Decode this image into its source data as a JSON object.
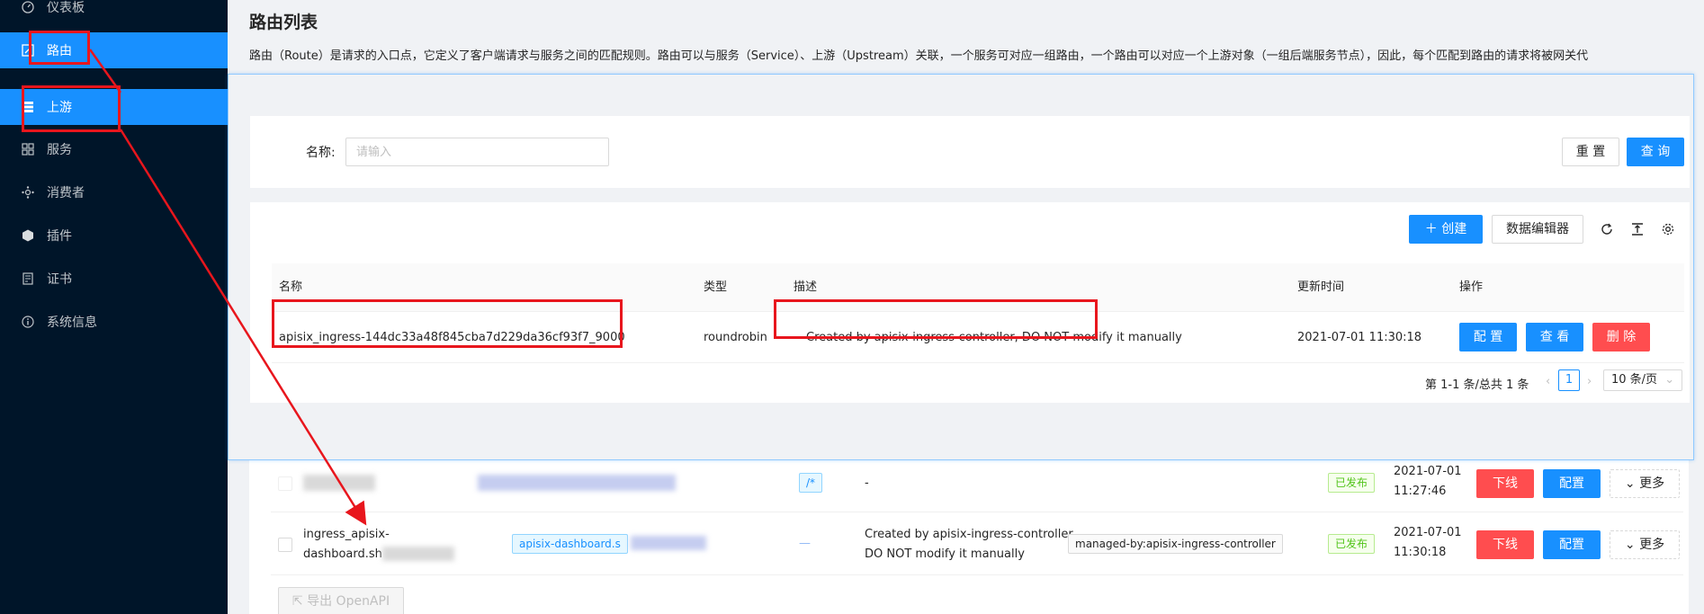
{
  "sidebar": {
    "items": [
      {
        "label": "仪表板",
        "icon": "dashboard-icon"
      },
      {
        "label": "路由",
        "icon": "route-icon"
      },
      {
        "label": "上游",
        "icon": "upstream-icon"
      },
      {
        "label": "服务",
        "icon": "service-icon"
      },
      {
        "label": "消费者",
        "icon": "consumer-icon"
      },
      {
        "label": "插件",
        "icon": "plugin-icon"
      },
      {
        "label": "证书",
        "icon": "certificate-icon"
      },
      {
        "label": "系统信息",
        "icon": "info-icon"
      }
    ],
    "bg_color": "#001529",
    "active_color": "#1890ff"
  },
  "page": {
    "title": "路由列表",
    "description": "路由（Route）是请求的入口点，它定义了客户端请求与服务之间的匹配规则。路由可以与服务（Service）、上游（Upstream）关联，一个服务可对应一组路由，一个路由可以对应一个上游对象（一组后端服务节点），因此，每个匹配到路由的请求将被网关代"
  },
  "route_table": {
    "rows": [
      {
        "desc": "-",
        "status": "已发布",
        "update_date": "2021-07-01",
        "update_time": "11:27:46",
        "offline_label": "下线",
        "config_label": "配置",
        "more_label": "更多"
      },
      {
        "name_line1": "ingress_apisix-",
        "name_line2": "dashboard.sh",
        "host_tag": "apisix-dashboard.s",
        "path": "—",
        "desc_line1": "Created by apisix-ingress-controller,",
        "desc_line2": "DO NOT modify it manually",
        "label_tag": "managed-by:apisix-ingress-controller",
        "status": "已发布",
        "update_date": "2021-07-01",
        "update_time": "11:30:18",
        "offline_label": "下线",
        "config_label": "配置",
        "more_label": "更多"
      }
    ],
    "path_tag": "/*",
    "export_label": "导出 OpenAPI"
  },
  "upstream_overlay": {
    "search": {
      "label": "名称:",
      "placeholder": "请输入",
      "reset_label": "重 置",
      "query_label": "查 询"
    },
    "toolbar": {
      "create_label": "创建",
      "data_editor_label": "数据编辑器"
    },
    "columns": [
      "名称",
      "类型",
      "描述",
      "更新时间",
      "操作"
    ],
    "row": {
      "name": "apisix_ingress-144dc33a48f845cba7d229da36cf93f7_9000",
      "type": "roundrobin",
      "desc": "Created by apisix-ingress-controller, DO NOT modify it manually",
      "updated": "2021-07-01 11:30:18",
      "config_label": "配 置",
      "view_label": "查 看",
      "delete_label": "删 除"
    },
    "pagination": {
      "summary": "第 1-1 条/总共 1 条",
      "current_page": "1",
      "page_size": "10 条/页"
    }
  },
  "colors": {
    "primary": "#1890ff",
    "danger": "#ff4d4f",
    "success": "#52c41a",
    "annotation_red": "#e8161d"
  }
}
